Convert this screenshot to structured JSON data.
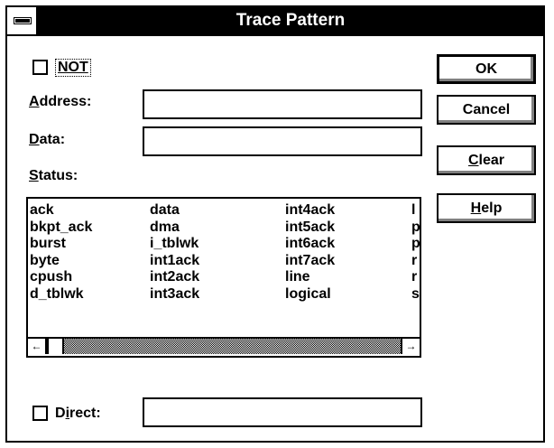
{
  "window": {
    "title": "Trace Pattern"
  },
  "not_checkbox": {
    "label": "NOT",
    "checked": false
  },
  "address": {
    "label_u": "A",
    "label_rest": "ddress:",
    "value": ""
  },
  "data_field": {
    "label_u": "D",
    "label_rest": "ata:",
    "value": ""
  },
  "status": {
    "label_u": "S",
    "label_rest": "tatus:"
  },
  "status_list": {
    "col1": [
      "ack",
      "bkpt_ack",
      "burst",
      "byte",
      "cpush",
      "d_tblwk"
    ],
    "col2": [
      "data",
      "dma",
      "i_tblwk",
      "int1ack",
      "int2ack",
      "int3ack"
    ],
    "col3": [
      "int4ack",
      "int5ack",
      "int6ack",
      "int7ack",
      "line",
      "logical"
    ],
    "col4": [
      "l",
      "p",
      "p",
      "r",
      "r",
      "s"
    ]
  },
  "direct": {
    "label_pre": "D",
    "label_u": "i",
    "label_rest": "rect:",
    "checked": false,
    "value": ""
  },
  "buttons": {
    "ok": "OK",
    "cancel": "Cancel",
    "clear_u": "C",
    "clear_rest": "lear",
    "help_u": "H",
    "help_rest": "elp"
  },
  "scrollbar": {
    "left_arrow": "←",
    "right_arrow": "→"
  }
}
